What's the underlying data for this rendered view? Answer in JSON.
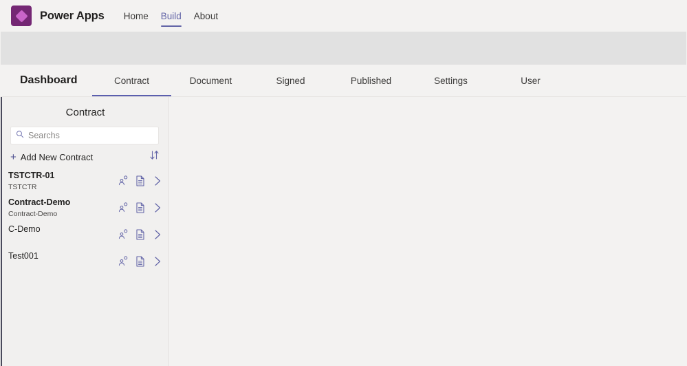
{
  "header": {
    "logo_icon": "power-apps-diamond-icon",
    "brand": "Power Apps",
    "nav": [
      {
        "label": "Home",
        "active": false
      },
      {
        "label": "Build",
        "active": true
      },
      {
        "label": "About",
        "active": false
      }
    ],
    "accent_color": "#6264A7",
    "logo_bg_color": "#742774",
    "logo_diamond_color": "#C965C9"
  },
  "tabbar": {
    "app_title": "Dashboard",
    "tabs": [
      {
        "label": "Contract",
        "active": true
      },
      {
        "label": "Document",
        "active": false
      },
      {
        "label": "Signed",
        "active": false
      },
      {
        "label": "Published",
        "active": false
      },
      {
        "label": "Settings",
        "active": false
      },
      {
        "label": "User",
        "active": false
      }
    ],
    "active_underline_color": "#5B5FAE"
  },
  "sidebar": {
    "title": "Contract",
    "search": {
      "value": "",
      "placeholder": "Searchs",
      "icon": "search-icon"
    },
    "add_new": {
      "label": "Add New Contract",
      "icon": "plus-icon"
    },
    "sort": {
      "icon": "sort-ascending-descending-icon"
    },
    "row_icons": {
      "share": "person-add-icon",
      "document": "document-icon",
      "open": "chevron-right-icon"
    },
    "icon_color": "#6264A7",
    "items": [
      {
        "title": "TSTCTR-01",
        "subtitle": "TSTCTR",
        "bold": true
      },
      {
        "title": "Contract-Demo",
        "subtitle": "Contract-Demo",
        "bold": true
      },
      {
        "title": "C-Demo",
        "subtitle": "",
        "bold": false
      },
      {
        "title": "Test001",
        "subtitle": "",
        "bold": false
      }
    ]
  },
  "main": {
    "content": ""
  }
}
